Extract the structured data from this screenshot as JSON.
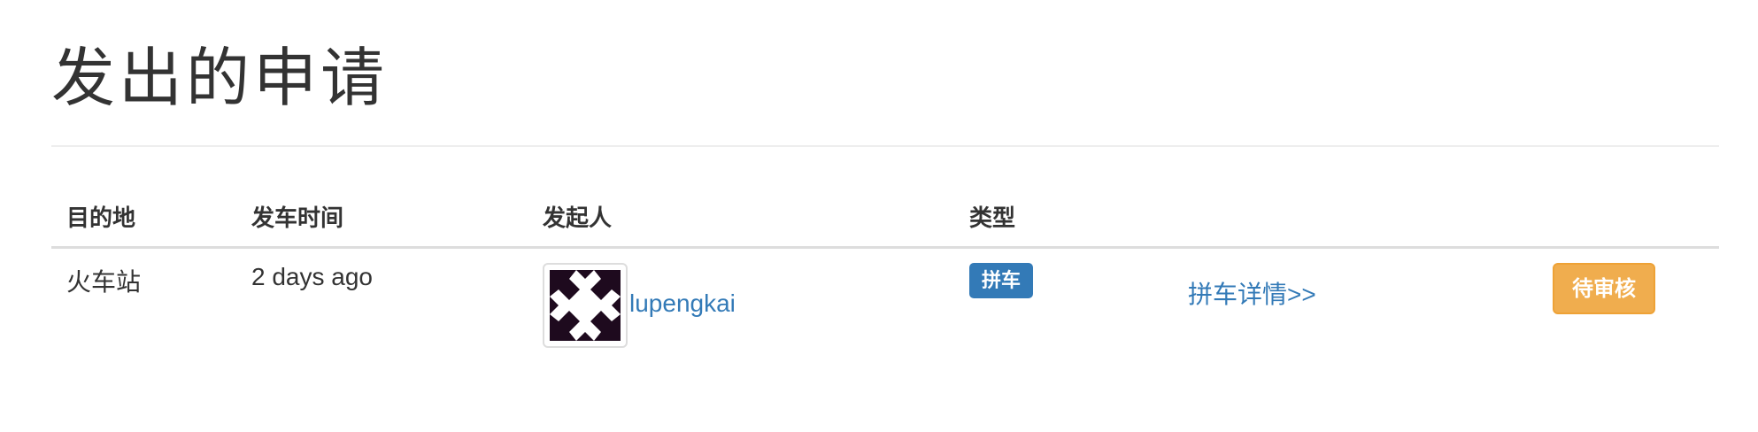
{
  "header": {
    "title": "发出的申请"
  },
  "table": {
    "columns": {
      "destination": "目的地",
      "departure_time": "发车时间",
      "initiator": "发起人",
      "type": "类型"
    },
    "rows": [
      {
        "destination": "火车站",
        "departure_time": "2 days ago",
        "initiator": "lupengkai",
        "avatar_icon": "identicon-avatar",
        "type": "拼车",
        "detail_link": "拼车详情>>",
        "status": "待审核"
      }
    ]
  },
  "colors": {
    "link": "#337ab7",
    "type_label_bg": "#337ab7",
    "status_warning": "#f0ad4e",
    "avatar_fill": "#1e0a1e"
  }
}
